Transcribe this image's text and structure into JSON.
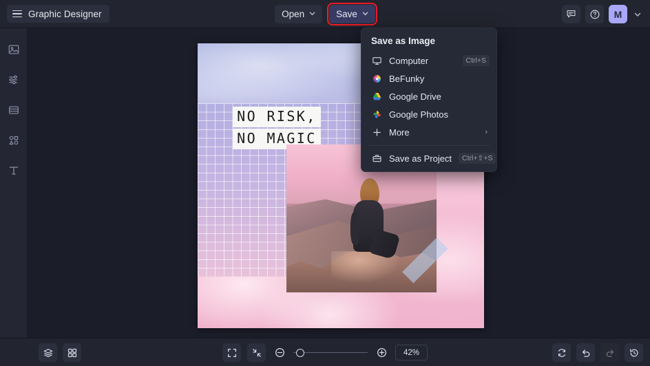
{
  "app": {
    "title": "Graphic Designer",
    "accent_purple": "#a9a7f9",
    "highlight_red": "#ee1c25",
    "topbar_bg": "#22242f",
    "canvas_bg": "#1b1d29"
  },
  "topbar": {
    "menu_icon": "hamburger-icon",
    "open_label": "Open",
    "save_label": "Save",
    "chevron_icon": "chevron-down-icon",
    "feedback_icon": "comment-icon",
    "help_icon": "question-circle-icon",
    "avatar_initial": "M",
    "account_chevron_icon": "chevron-down-icon"
  },
  "sidebar": {
    "items": [
      {
        "icon": "image-icon",
        "name": "sidebar-item-image"
      },
      {
        "icon": "sliders-icon",
        "name": "sidebar-item-edit"
      },
      {
        "icon": "layout-icon",
        "name": "sidebar-item-layout"
      },
      {
        "icon": "shapes-icon",
        "name": "sidebar-item-graphics"
      },
      {
        "icon": "text-icon",
        "name": "sidebar-item-text"
      }
    ]
  },
  "save_menu": {
    "title": "Save as Image",
    "items": [
      {
        "label": "Computer",
        "icon": "monitor-icon",
        "shortcut": "Ctrl+S",
        "arrow": ""
      },
      {
        "label": "BeFunky",
        "icon": "befunky-logo-icon",
        "shortcut": "",
        "arrow": ""
      },
      {
        "label": "Google Drive",
        "icon": "google-drive-icon",
        "shortcut": "",
        "arrow": ""
      },
      {
        "label": "Google Photos",
        "icon": "google-photos-icon",
        "shortcut": "",
        "arrow": ""
      },
      {
        "label": "More",
        "icon": "plus-icon",
        "shortcut": "",
        "arrow": "›"
      }
    ],
    "project": {
      "label": "Save as Project",
      "icon": "briefcase-icon",
      "shortcut": "Ctrl+⇧+S"
    }
  },
  "canvas": {
    "headline_line1": "NO RISK,",
    "headline_line2": "NO MAGIC",
    "photo_alt": "woman-sitting-on-rock-photo",
    "tape_alt": "blue-tape-strip"
  },
  "bottombar": {
    "layers_icon": "layers-icon",
    "templates_icon": "grid-icon",
    "fit_icon": "fit-to-screen-icon",
    "actual_icon": "collapse-icon",
    "zoom_out_icon": "minus-circle-icon",
    "zoom_in_icon": "plus-circle-icon",
    "zoom_value": "42%",
    "reset_icon": "reset-icon",
    "undo_icon": "undo-icon",
    "redo_icon": "redo-icon",
    "history_icon": "history-icon"
  }
}
